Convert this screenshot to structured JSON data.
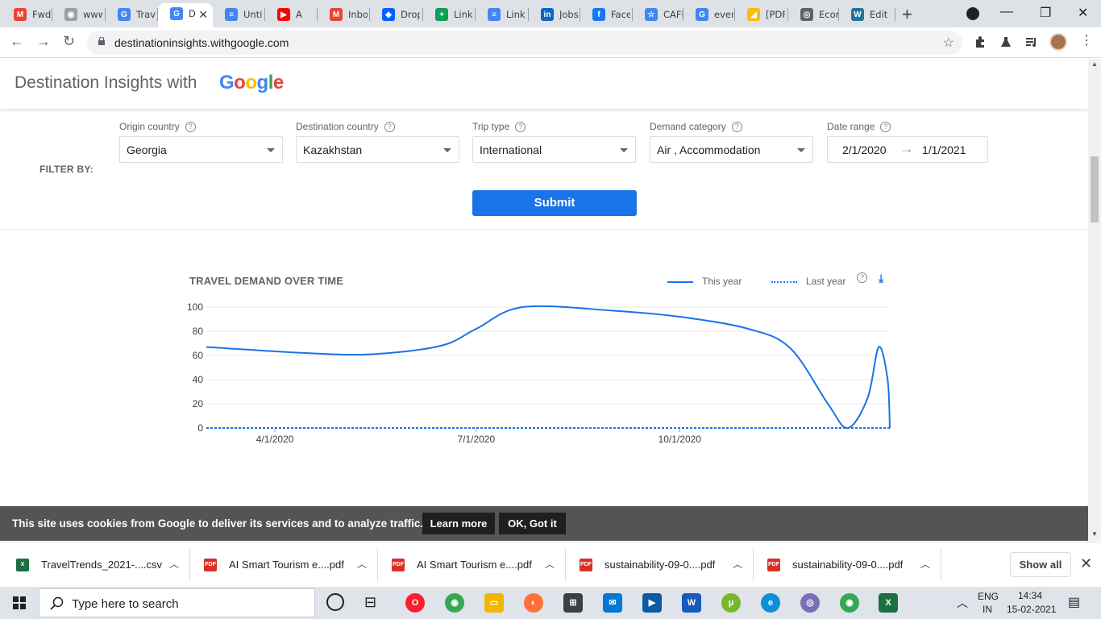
{
  "browser": {
    "tabs": [
      {
        "label": "Fwd:",
        "fav": "M",
        "color": "#ea4335"
      },
      {
        "label": "www",
        "fav": "◉",
        "color": "#9aa0a6"
      },
      {
        "label": "Trave",
        "fav": "G",
        "color": "#4285f4"
      },
      {
        "label": "D",
        "fav": "G",
        "color": "#4285f4"
      },
      {
        "label": "Untit",
        "fav": "≡",
        "color": "#4285f4"
      },
      {
        "label": "A",
        "fav": "▶",
        "color": "#ff0000"
      },
      {
        "label": "Inbo",
        "fav": "M",
        "color": "#ea4335"
      },
      {
        "label": "Drop",
        "fav": "◆",
        "color": "#0061ff"
      },
      {
        "label": "Links",
        "fav": "+",
        "color": "#0f9d58"
      },
      {
        "label": "Links",
        "fav": "≡",
        "color": "#4285f4"
      },
      {
        "label": "Jobs",
        "fav": "in",
        "color": "#0a66c2"
      },
      {
        "label": "Face",
        "fav": "f",
        "color": "#1877f2"
      },
      {
        "label": "CAFI",
        "fav": "☆",
        "color": "#4285f4"
      },
      {
        "label": "even",
        "fav": "G",
        "color": "#4285f4"
      },
      {
        "label": "[PDF",
        "fav": "◢",
        "color": "#fbbc05"
      },
      {
        "label": "Econ",
        "fav": "◎",
        "color": "#5f6368"
      },
      {
        "label": "Edit",
        "fav": "W",
        "color": "#21759b"
      }
    ],
    "url": "destinationinsights.withgoogle.com"
  },
  "site": {
    "title": "Destination Insights with",
    "logo_letters": [
      {
        "ch": "G",
        "color": "#4285f4"
      },
      {
        "ch": "o",
        "color": "#ea4335"
      },
      {
        "ch": "o",
        "color": "#fbbc05"
      },
      {
        "ch": "g",
        "color": "#4285f4"
      },
      {
        "ch": "l",
        "color": "#34a853"
      },
      {
        "ch": "e",
        "color": "#ea4335"
      }
    ]
  },
  "filters": {
    "label": "FILTER BY:",
    "origin_label": "Origin country",
    "origin_value": "Georgia",
    "destination_label": "Destination country",
    "destination_value": "Kazakhstan",
    "trip_label": "Trip type",
    "trip_value": "International",
    "demand_label": "Demand category",
    "demand_value": "Air , Accommodation",
    "date_label": "Date range",
    "date_start": "2/1/2020",
    "date_end": "1/1/2021",
    "submit": "Submit"
  },
  "chart_data": {
    "type": "line",
    "title": "TRAVEL DEMAND OVER TIME",
    "ylim": [
      0,
      100
    ],
    "yticks": [
      0,
      20,
      40,
      60,
      80,
      100
    ],
    "xticks": [
      "4/1/2020",
      "7/1/2020",
      "10/1/2020"
    ],
    "series": [
      {
        "name": "This year",
        "style": "solid",
        "color": "#1a73e8",
        "points": [
          {
            "x": "2020-03-01",
            "y": 67
          },
          {
            "x": "2020-04-15",
            "y": 62
          },
          {
            "x": "2020-05-15",
            "y": 61
          },
          {
            "x": "2020-06-15",
            "y": 68
          },
          {
            "x": "2020-07-01",
            "y": 82
          },
          {
            "x": "2020-07-22",
            "y": 100
          },
          {
            "x": "2020-09-01",
            "y": 97
          },
          {
            "x": "2020-10-01",
            "y": 92
          },
          {
            "x": "2020-11-01",
            "y": 82
          },
          {
            "x": "2020-11-20",
            "y": 66
          },
          {
            "x": "2020-12-07",
            "y": 20
          },
          {
            "x": "2020-12-16",
            "y": 0
          },
          {
            "x": "2020-12-25",
            "y": 25
          },
          {
            "x": "2020-12-30",
            "y": 67
          },
          {
            "x": "2021-01-03",
            "y": 40
          },
          {
            "x": "2021-01-04",
            "y": 0
          }
        ]
      },
      {
        "name": "Last year",
        "style": "dotted",
        "color": "#1a73e8",
        "points": [
          {
            "x": "2020-03-01",
            "y": 0
          },
          {
            "x": "2021-01-04",
            "y": 0
          }
        ]
      }
    ]
  },
  "cookie": {
    "text": "This site uses cookies from Google to deliver its services and to analyze traffic.",
    "learn_more": "Learn more",
    "ok": "OK, Got it"
  },
  "downloads": [
    {
      "name": "TravelTrends_2021-....csv",
      "type": "X",
      "color": "#1d6f42"
    },
    {
      "name": "AI Smart Tourism e....pdf",
      "type": "PDF",
      "color": "#d93025"
    },
    {
      "name": "AI Smart Tourism e....pdf",
      "type": "PDF",
      "color": "#d93025"
    },
    {
      "name": "sustainability-09-0....pdf",
      "type": "PDF",
      "color": "#d93025"
    },
    {
      "name": "sustainability-09-0....pdf",
      "type": "PDF",
      "color": "#d93025"
    }
  ],
  "shelf": {
    "show_all": "Show all"
  },
  "taskbar": {
    "search_placeholder": "Type here to search",
    "lang1": "ENG",
    "lang2": "IN",
    "time": "14:34",
    "date": "15-02-2021"
  }
}
